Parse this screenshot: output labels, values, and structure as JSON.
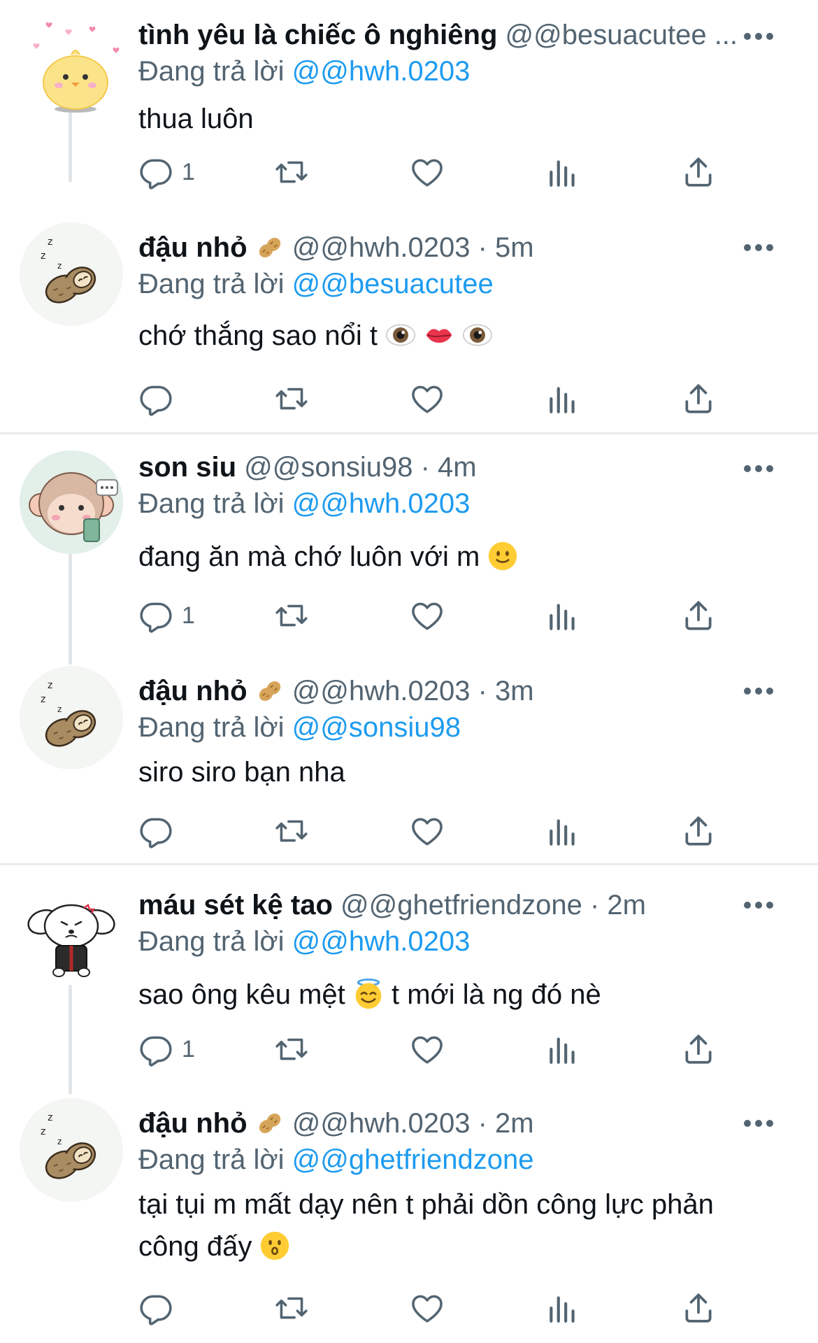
{
  "tweets": [
    {
      "name": "tình yêu là chiếc ô nghiêng",
      "handle": "@@besuacutee ...",
      "reply_prefix": "Đang trả lời",
      "reply_to": "@@hwh.0203",
      "text": "thua luôn",
      "reply_count": "1",
      "avatar": "chick-avatar"
    },
    {
      "name": "đậu nhỏ",
      "handle": "@@hwh.0203 · 5m",
      "reply_prefix": "Đang trả lời",
      "reply_to": "@@besuacutee",
      "text": "chớ thắng sao nổi t",
      "reply_count": "",
      "avatar": "peanut-avatar"
    },
    {
      "name": "son siu",
      "handle": "@@sonsiu98 · 4m",
      "reply_prefix": "Đang trả lời",
      "reply_to": "@@hwh.0203",
      "text": "đang ăn mà chớ luôn với m",
      "reply_count": "1",
      "avatar": "monkey-avatar"
    },
    {
      "name": "đậu nhỏ",
      "handle": "@@hwh.0203 · 3m",
      "reply_prefix": "Đang trả lời",
      "reply_to": "@@sonsiu98",
      "text": "siro siro bạn nha",
      "reply_count": "",
      "avatar": "peanut-avatar"
    },
    {
      "name": "máu sét kệ tao",
      "handle": "@@ghetfriendzone · 2m",
      "reply_prefix": "Đang trả lời",
      "reply_to": "@@hwh.0203",
      "text_before": "sao ông kêu mệt",
      "text_after": "t mới là ng đó nè",
      "reply_count": "1",
      "avatar": "dog-avatar"
    },
    {
      "name": "đậu nhỏ",
      "handle": "@@hwh.0203 · 2m",
      "reply_prefix": "Đang trả lời",
      "reply_to": "@@ghetfriendzone",
      "text_line1": "tại tụi m mất dạy nên t phải dồn công lực phản",
      "text_line2": "công đấy",
      "reply_count": "",
      "avatar": "peanut-avatar"
    }
  ],
  "colors": {
    "text": "#0f1419",
    "secondary": "#536471",
    "mention": "#1d9bf0",
    "divider": "#e9ecef"
  }
}
